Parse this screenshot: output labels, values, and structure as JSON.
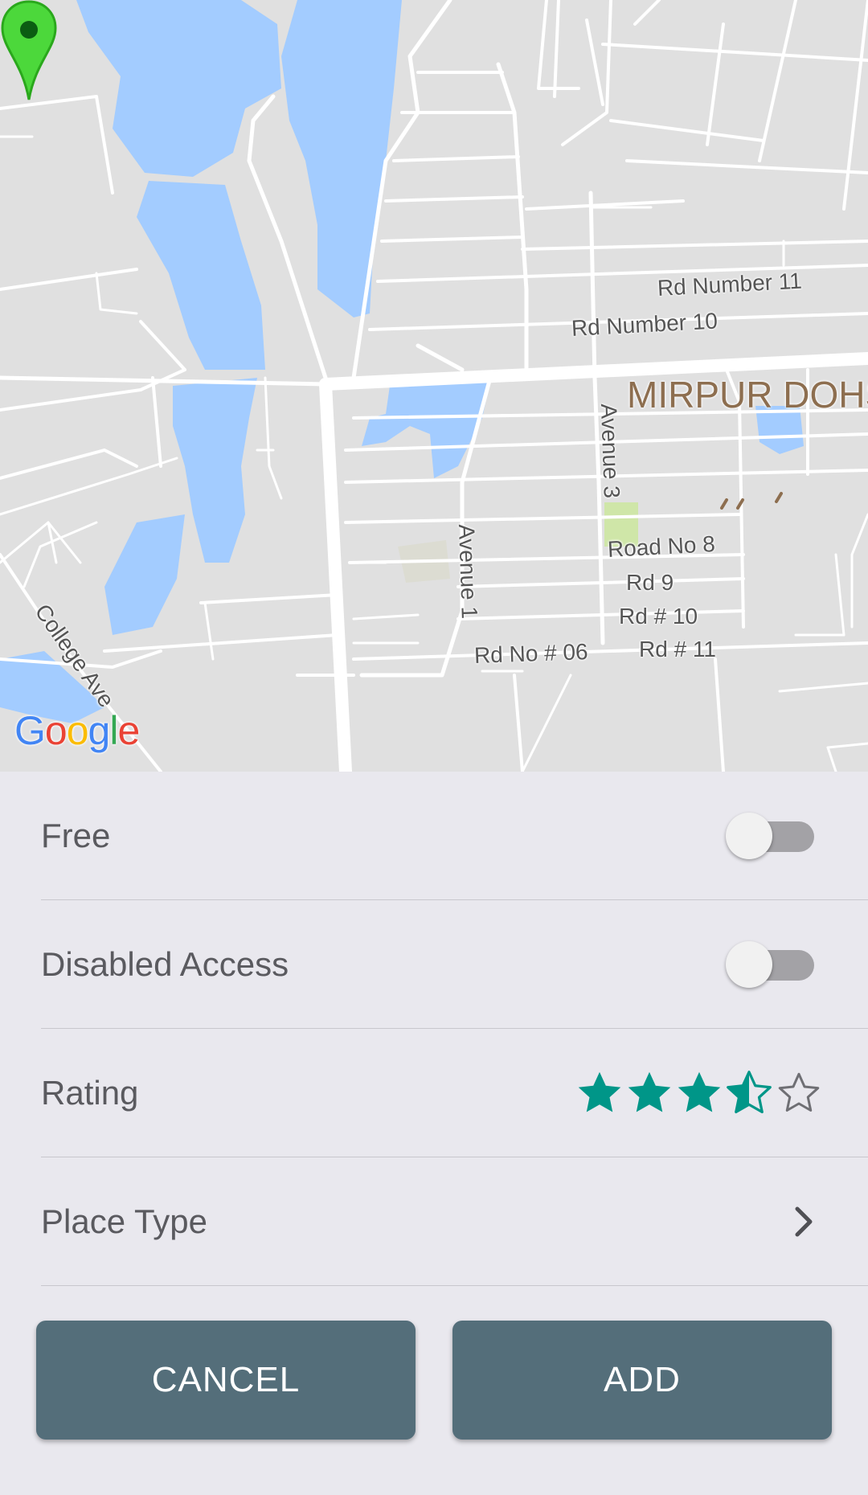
{
  "map": {
    "streets": {
      "rd_number_11": "Rd Number 11",
      "rd_number_10": "Rd Number 10",
      "avenue_3": "Avenue 3",
      "avenue_1": "Avenue 1",
      "road_no_8": "Road No 8",
      "rd_9": "Rd 9",
      "rd_hash_10": "Rd # 10",
      "rd_hash_11": "Rd # 11",
      "rd_no_06": "Rd No # 06",
      "college_ave": "College Ave"
    },
    "area_label": "MIRPUR DOHS",
    "logo": {
      "g1": "G",
      "o1": "o",
      "o2": "o",
      "g2": "g",
      "l": "l",
      "e": "e"
    },
    "colors": {
      "land": "#e0e0e0",
      "water": "#a3ccff",
      "road": "#ffffff",
      "park": "#cfe6a8",
      "pin": "#4cd83b"
    },
    "pin_icon": "map-marker-icon"
  },
  "form": {
    "free": {
      "label": "Free",
      "toggled": false
    },
    "disabled_access": {
      "label": "Disabled Access",
      "toggled": false
    },
    "rating": {
      "label": "Rating",
      "value": 3.5,
      "max": 5,
      "color": "#009688"
    },
    "place_type": {
      "label": "Place Type",
      "icon": "chevron-right-icon"
    }
  },
  "buttons": {
    "cancel": "CANCEL",
    "add": "ADD",
    "color": "#546e7a"
  }
}
